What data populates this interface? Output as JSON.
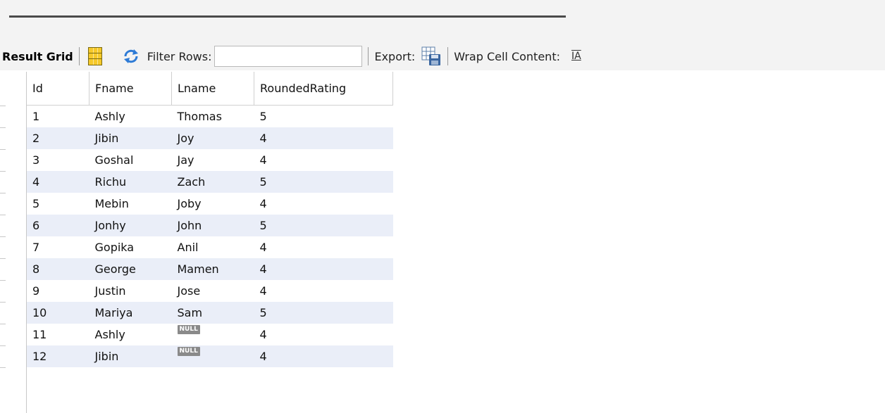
{
  "toolbar": {
    "result_grid_label": "Result Grid",
    "filter_label": "Filter Rows:",
    "filter_value": "",
    "export_label": "Export:",
    "wrap_label": "Wrap Cell Content:",
    "wrap_icon": "̲I̲A"
  },
  "icons": {
    "grid": "grid-icon",
    "refresh": "refresh-icon",
    "export": "export-icon",
    "wrap": "wrap-text-icon"
  },
  "colors": {
    "toolbar_bg": "#f3f3f3",
    "alt_row_bg": "#eaeef8",
    "null_badge_bg": "#8a8a8a",
    "grid_icon": "#f6c92a",
    "refresh_icon": "#2e7bd6"
  },
  "table": {
    "columns": [
      "Id",
      "Fname",
      "Lname",
      "RoundedRating"
    ],
    "rows": [
      [
        "1",
        "Ashly",
        "Thomas",
        "5"
      ],
      [
        "2",
        "Jibin",
        "Joy",
        "4"
      ],
      [
        "3",
        "Goshal",
        "Jay",
        "4"
      ],
      [
        "4",
        "Richu",
        "Zach",
        "5"
      ],
      [
        "5",
        "Mebin",
        "Joby",
        "4"
      ],
      [
        "6",
        "Jonhy",
        "John",
        "5"
      ],
      [
        "7",
        "Gopika",
        "Anil",
        "4"
      ],
      [
        "8",
        "George",
        "Mamen",
        "4"
      ],
      [
        "9",
        "Justin",
        "Jose",
        "4"
      ],
      [
        "10",
        "Mariya",
        "Sam",
        "5"
      ],
      [
        "11",
        "Ashly",
        "NULL",
        "4"
      ],
      [
        "12",
        "Jibin",
        "NULL",
        "4"
      ]
    ]
  }
}
